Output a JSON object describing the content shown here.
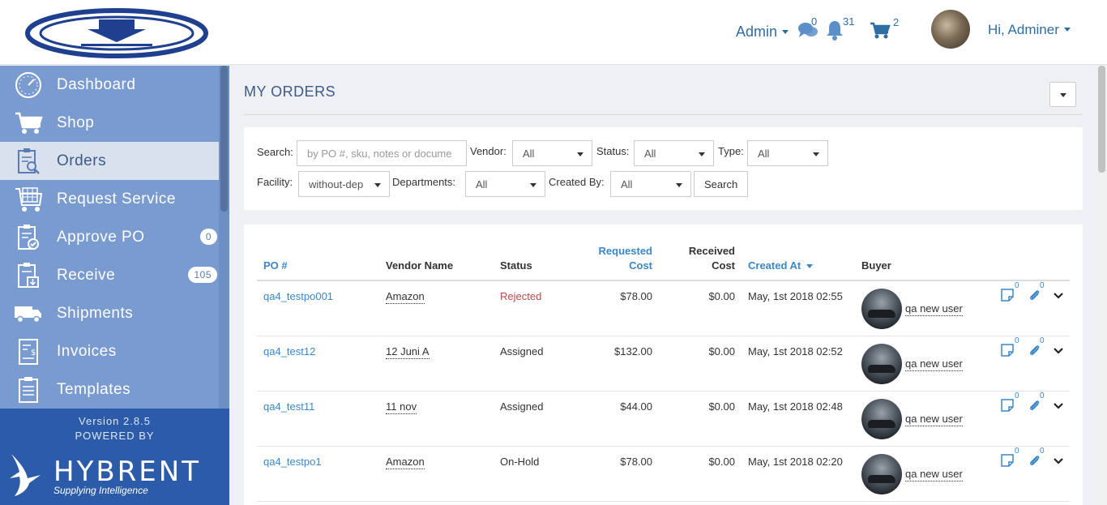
{
  "header": {
    "admin_menu": "Admin",
    "messages_count": "0",
    "notifications_count": "31",
    "cart_count": "2",
    "user_greeting": "Hi, Adminer"
  },
  "sidebar": {
    "items": [
      {
        "label": "Dashboard",
        "icon": "dashboard-icon"
      },
      {
        "label": "Shop",
        "icon": "cart-icon"
      },
      {
        "label": "Orders",
        "icon": "orders-icon"
      },
      {
        "label": "Request Service",
        "icon": "request-service-icon"
      },
      {
        "label": "Approve PO",
        "icon": "approve-po-icon",
        "badge": "0"
      },
      {
        "label": "Receive",
        "icon": "receive-icon",
        "badge": "105"
      },
      {
        "label": "Shipments",
        "icon": "truck-icon"
      },
      {
        "label": "Invoices",
        "icon": "invoice-icon"
      },
      {
        "label": "Templates",
        "icon": "templates-icon"
      }
    ],
    "active": "Orders",
    "version": "Version 2.8.5",
    "powered_by": "POWERED BY",
    "brand": "HYBRENT",
    "brand_tagline": "Supplying Intelligence"
  },
  "page": {
    "title": "MY ORDERS"
  },
  "filters": {
    "search_label": "Search:",
    "search_placeholder": "by PO #, sku, notes or docume",
    "vendor_label": "Vendor:",
    "vendor_value": "All",
    "status_label": "Status:",
    "status_value": "All",
    "type_label": "Type:",
    "type_value": "All",
    "facility_label": "Facility:",
    "facility_value": "without-dep",
    "departments_label": "Departments:",
    "departments_value": "All",
    "created_by_label": "Created By:",
    "created_by_value": "All",
    "search_button": "Search"
  },
  "table": {
    "headers": {
      "po": "PO #",
      "vendor": "Vendor Name",
      "status": "Status",
      "requested_cost_1": "Requested",
      "requested_cost_2": "Cost",
      "received_cost_1": "Received",
      "received_cost_2": "Cost",
      "created_at": "Created At",
      "buyer": "Buyer"
    },
    "rows": [
      {
        "po": "qa4_testpo001",
        "vendor": "Amazon",
        "status": "Rejected",
        "requested": "$78.00",
        "received": "$0.00",
        "created": "May, 1st 2018 02:55",
        "buyer": "qa new user",
        "notes": "0",
        "attachments": "0"
      },
      {
        "po": "qa4_test12",
        "vendor": "12 Juni A",
        "status": "Assigned",
        "requested": "$132.00",
        "received": "$0.00",
        "created": "May, 1st 2018 02:52",
        "buyer": "qa new user",
        "notes": "0",
        "attachments": "0"
      },
      {
        "po": "qa4_test11",
        "vendor": "11 nov",
        "status": "Assigned",
        "requested": "$44.00",
        "received": "$0.00",
        "created": "May, 1st 2018 02:48",
        "buyer": "qa new user",
        "notes": "0",
        "attachments": "0"
      },
      {
        "po": "qa4_testpo1",
        "vendor": "Amazon",
        "status": "On-Hold",
        "requested": "$78.00",
        "received": "$0.00",
        "created": "May, 1st 2018 02:20",
        "buyer": "qa new user",
        "notes": "0",
        "attachments": "0"
      }
    ]
  },
  "colors": {
    "sidebar": "#7a9bd0",
    "sidebar_bottom": "#2c5baa",
    "link": "#3a87c8",
    "header_link": "#2e6da4",
    "rejected": "#b94a48"
  }
}
